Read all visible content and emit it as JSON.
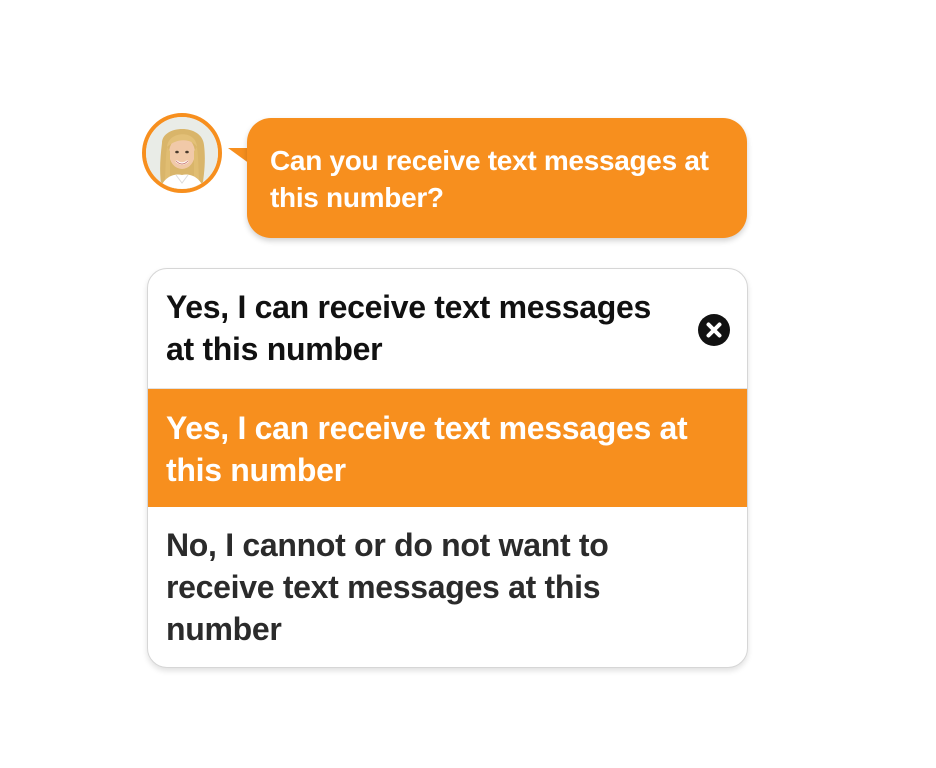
{
  "assistant": {
    "avatar_icon": "woman-portrait-avatar",
    "question": "Can you receive text messages at this number?"
  },
  "options": {
    "selected_label": "Yes, I can receive text messages at this number",
    "clear_icon": "close-icon",
    "items": [
      {
        "label": "Yes, I can receive text messages at this number",
        "highlighted": true
      },
      {
        "label": "No, I cannot or do not want to receive text messages at this number",
        "highlighted": false
      }
    ]
  },
  "colors": {
    "accent": "#f78f1e",
    "text_dark": "#111111",
    "text_white": "#ffffff",
    "border": "#d6d6d6"
  }
}
